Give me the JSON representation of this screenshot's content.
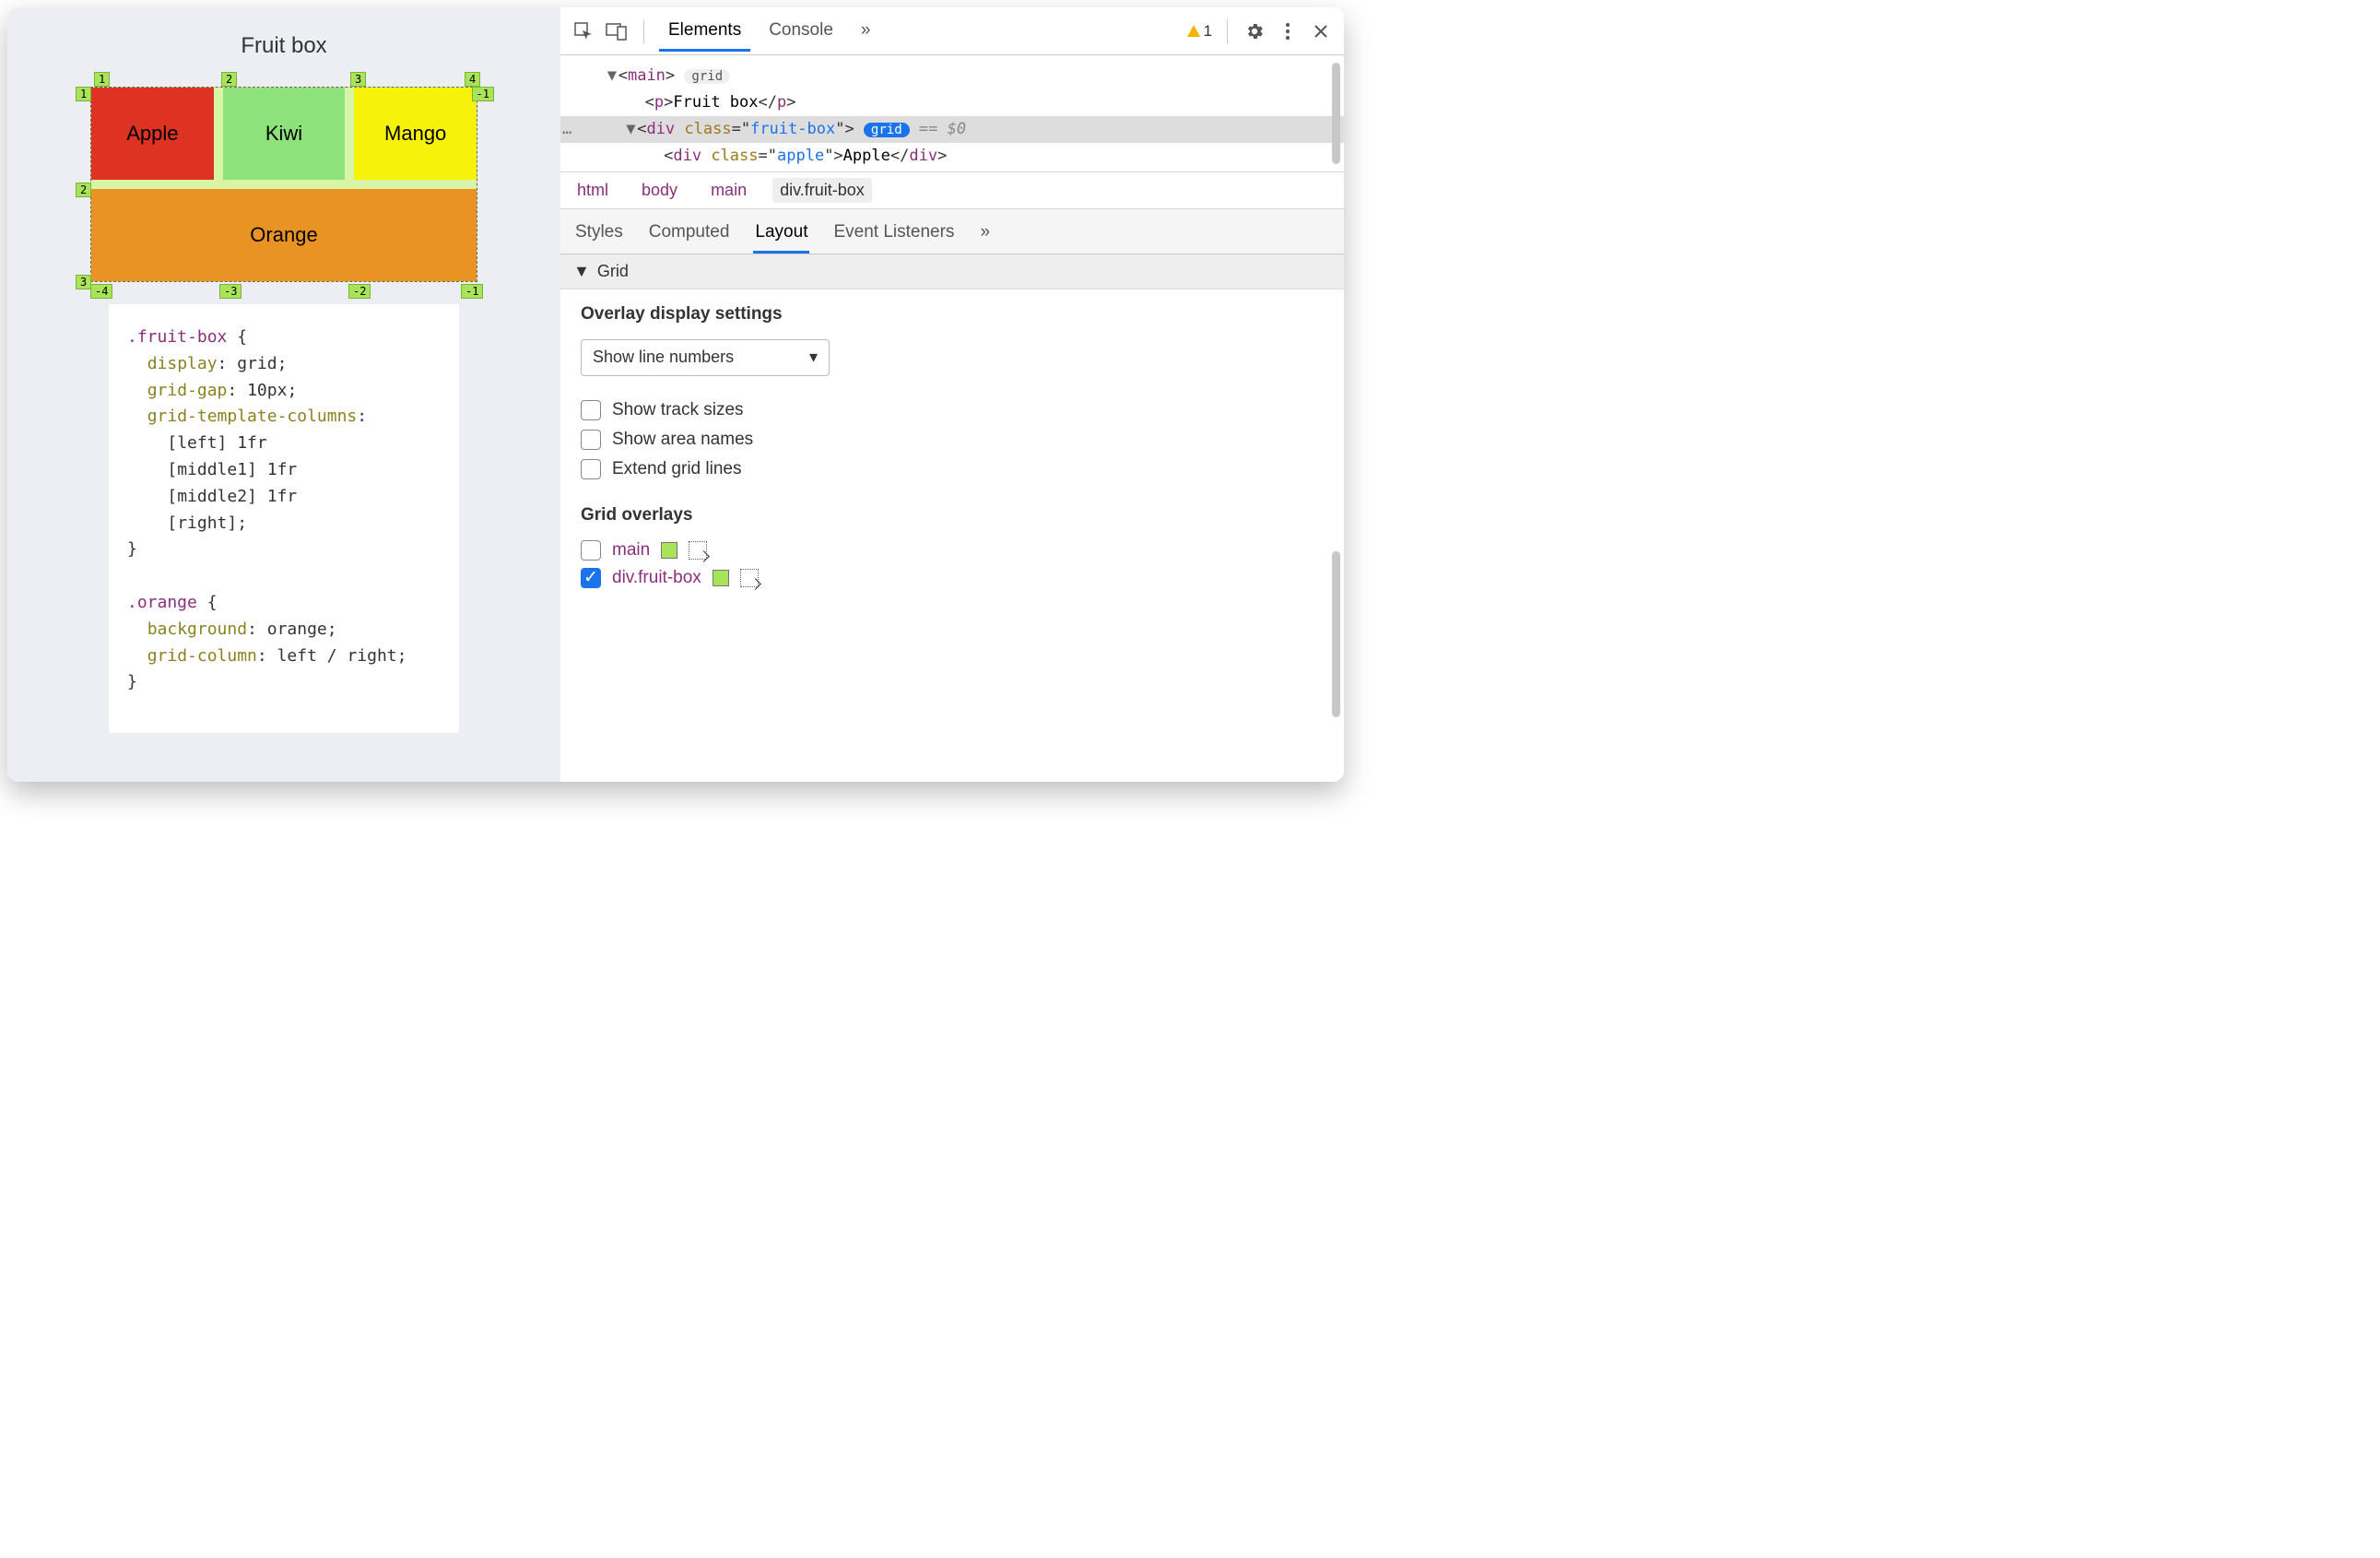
{
  "demo": {
    "title": "Fruit box",
    "fruits": {
      "apple": "Apple",
      "kiwi": "Kiwi",
      "mango": "Mango",
      "orange": "Orange"
    },
    "pins_top": [
      "1",
      "2",
      "3",
      "4"
    ],
    "pins_left": [
      "1",
      "2",
      "3"
    ],
    "pins_right": [
      "-1"
    ],
    "pins_bottom": [
      "-4",
      "-3",
      "-2",
      "-1"
    ],
    "code": {
      "sel1": ".fruit-box",
      "decl1_prop": "display",
      "decl1_val": "grid",
      "decl2_prop": "grid-gap",
      "decl2_val": "10px",
      "decl3_prop": "grid-template-columns",
      "decl3_l1": "[left] 1fr",
      "decl3_l2": "[middle1] 1fr",
      "decl3_l3": "[middle2] 1fr",
      "decl3_l4": "[right]",
      "sel2": ".orange",
      "decl4_prop": "background",
      "decl4_val": "orange",
      "decl5_prop": "grid-column",
      "decl5_val": "left / right"
    }
  },
  "devtools": {
    "tabs": {
      "elements": "Elements",
      "console": "Console",
      "more": "»"
    },
    "warnings": "1",
    "dom": {
      "main_tag": "main",
      "main_badge": "grid",
      "p_tag": "p",
      "p_text": "Fruit box",
      "div_tag": "div",
      "div_attr": "class",
      "div_class": "fruit-box",
      "div_badge": "grid",
      "div_trail": "== $0",
      "child_tag": "div",
      "child_attr": "class",
      "child_class": "apple",
      "child_text": "Apple"
    },
    "breadcrumbs": [
      "html",
      "body",
      "main",
      "div.fruit-box"
    ],
    "subtabs": {
      "styles": "Styles",
      "computed": "Computed",
      "layout": "Layout",
      "listeners": "Event Listeners",
      "more": "»"
    },
    "layout": {
      "section": "Grid",
      "h_overlay": "Overlay display settings",
      "select_value": "Show line numbers",
      "opt_track": "Show track sizes",
      "opt_area": "Show area names",
      "opt_extend": "Extend grid lines",
      "h_overlays": "Grid overlays",
      "rows": [
        {
          "name": "main",
          "checked": false,
          "swatch": "#a8e35a"
        },
        {
          "name": "div.fruit-box",
          "checked": true,
          "swatch": "#a8e35a"
        }
      ]
    }
  }
}
